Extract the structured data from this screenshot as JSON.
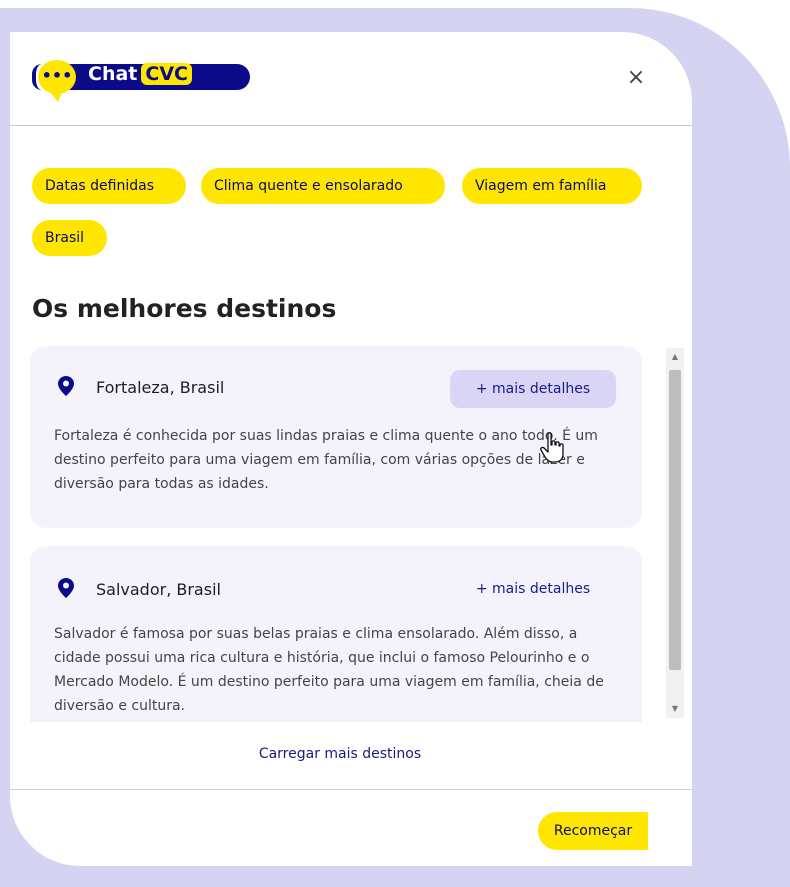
{
  "header": {
    "logo_dots": "•••",
    "logo_word1": "Chat",
    "logo_word2": "CVC",
    "close_label": "×"
  },
  "filters": [
    "Datas definidas",
    "Clima quente e ensolarado",
    "Viagem em família",
    "Brasil"
  ],
  "section_title": "Os melhores destinos",
  "destinations": [
    {
      "name": "Fortaleza, Brasil",
      "details_label": "+ mais detalhes",
      "description": "Fortaleza é conhecida por suas lindas praias e clima quente o ano todo. É um destino perfeito para uma viagem em família, com várias opções de lazer e diversão para todas as idades."
    },
    {
      "name": "Salvador, Brasil",
      "details_label": "+ mais detalhes",
      "description": "Salvador é famosa por suas belas praias e clima ensolarado. Além disso, a cidade possui uma rica cultura e história, que inclui o famoso Pelourinho e o Mercado Modelo. É um destino perfeito para uma viagem em família, cheia de diversão e cultura."
    }
  ],
  "load_more_label": "Carregar mais destinos",
  "restart_label": "Recomeçar",
  "icons": {
    "logo": "chat-bubble-icon",
    "close": "close-icon",
    "pin": "map-pin-icon",
    "cursor": "hand-pointer-icon"
  },
  "colors": {
    "brand_yellow": "#ffe600",
    "brand_navy": "#0b0b8a",
    "background_lavender": "#d4d4f2",
    "card_tint": "#f4f3fb",
    "details_hover": "#d8d6f4"
  }
}
